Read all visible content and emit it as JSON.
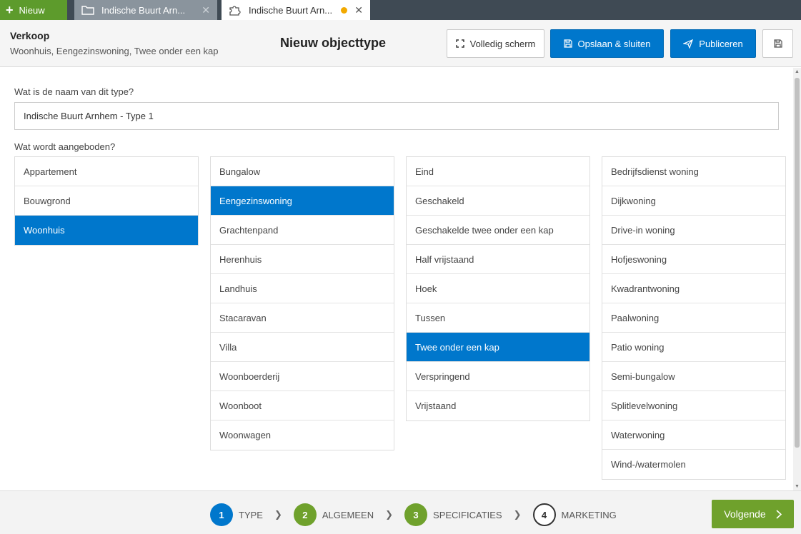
{
  "tabs": {
    "new_label": "Nieuw",
    "items": [
      {
        "label": "Indische Buurt Arn..."
      },
      {
        "label": "Indische Buurt Arn..."
      }
    ]
  },
  "header": {
    "title": "Verkoop",
    "subtitle": "Woonhuis, Eengezinswoning, Twee onder een kap",
    "page_title": "Nieuw objecttype",
    "fullscreen_label": "Volledig scherm",
    "save_close_label": "Opslaan & sluiten",
    "publish_label": "Publiceren"
  },
  "form": {
    "name_question": "Wat is de naam van dit type?",
    "name_value": "Indische Buurt Arnhem - Type 1",
    "offered_question": "Wat wordt aangeboden?"
  },
  "columns": [
    {
      "options": [
        "Appartement",
        "Bouwgrond",
        "Woonhuis"
      ],
      "selected": "Woonhuis"
    },
    {
      "options": [
        "Bungalow",
        "Eengezinswoning",
        "Grachtenpand",
        "Herenhuis",
        "Landhuis",
        "Stacaravan",
        "Villa",
        "Woonboerderij",
        "Woonboot",
        "Woonwagen"
      ],
      "selected": "Eengezinswoning"
    },
    {
      "options": [
        "Eind",
        "Geschakeld",
        "Geschakelde twee onder een kap",
        "Half vrijstaand",
        "Hoek",
        "Tussen",
        "Twee onder een kap",
        "Verspringend",
        "Vrijstaand"
      ],
      "selected": "Twee onder een kap"
    },
    {
      "options": [
        "Bedrijfsdienst woning",
        "Dijkwoning",
        "Drive-in woning",
        "Hofjeswoning",
        "Kwadrantwoning",
        "Paalwoning",
        "Patio woning",
        "Semi-bungalow",
        "Splitlevelwoning",
        "Waterwoning",
        "Wind-/watermolen"
      ],
      "selected": ""
    }
  ],
  "steps": [
    {
      "number": "1",
      "label": "TYPE",
      "state": "current"
    },
    {
      "number": "2",
      "label": "ALGEMEEN",
      "state": "done"
    },
    {
      "number": "3",
      "label": "SPECIFICATIES",
      "state": "done"
    },
    {
      "number": "4",
      "label": "MARKETING",
      "state": "todo"
    }
  ],
  "footer": {
    "next_label": "Volgende"
  },
  "colors": {
    "primary": "#0077cc",
    "green": "#6fa12c",
    "unsaved_dot": "#f2a900"
  }
}
